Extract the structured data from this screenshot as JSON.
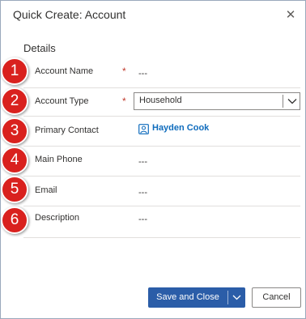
{
  "dialog": {
    "title": "Quick Create: Account",
    "close_icon": "close-icon",
    "section_title": "Details"
  },
  "fields": [
    {
      "number": "1",
      "label": "Account Name",
      "required": "*",
      "value": "---"
    },
    {
      "number": "2",
      "label": "Account Type",
      "required": "*",
      "value": "Household"
    },
    {
      "number": "3",
      "label": "Primary Contact",
      "value": "Hayden Cook",
      "icon": "contact-icon"
    },
    {
      "number": "4",
      "label": "Main Phone",
      "value": "---"
    },
    {
      "number": "5",
      "label": "Email",
      "value": "---"
    },
    {
      "number": "6",
      "label": "Description",
      "value": "---"
    }
  ],
  "footer": {
    "save_close_label": "Save and Close",
    "cancel_label": "Cancel"
  },
  "colors": {
    "badge": "#d9211e",
    "primary_button": "#2b5da8",
    "link": "#0f6cbd",
    "required": "#c0392b"
  }
}
